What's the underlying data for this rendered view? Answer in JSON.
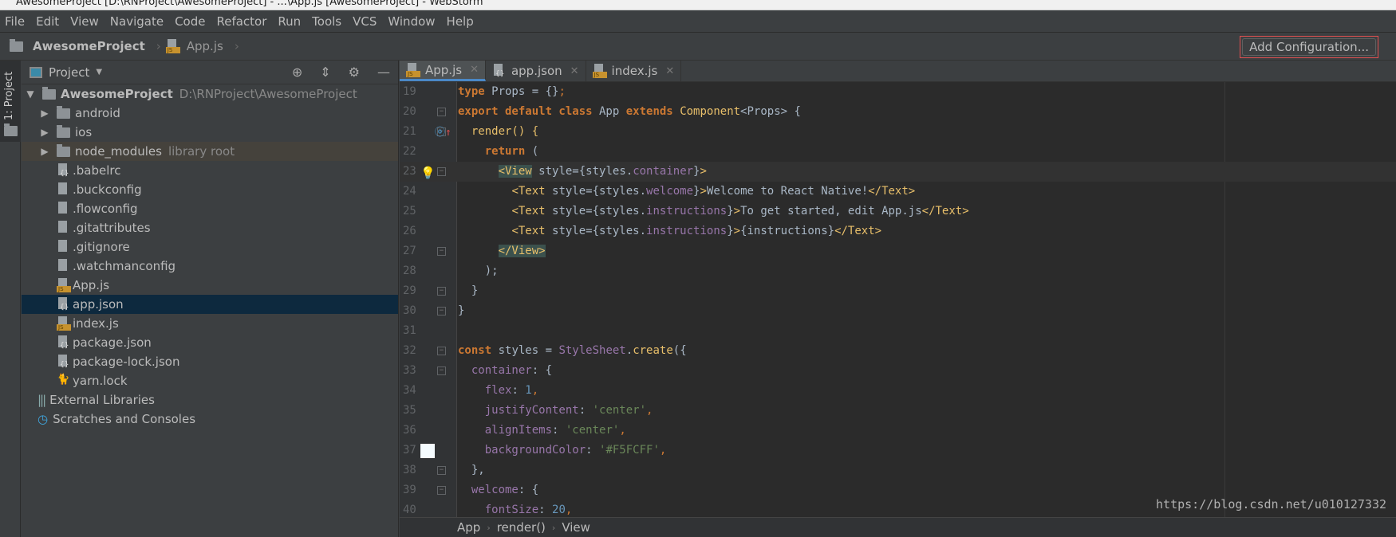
{
  "window": {
    "title": "AwesomeProject [D:\\RNProject\\AwesomeProject] - ...\\App.js [AwesomeProject] - WebStorm"
  },
  "menu": [
    "File",
    "Edit",
    "View",
    "Navigate",
    "Code",
    "Refactor",
    "Run",
    "Tools",
    "VCS",
    "Window",
    "Help"
  ],
  "nav": {
    "project": "AwesomeProject",
    "file": "App.js",
    "add_config": "Add Configuration..."
  },
  "stripe": {
    "project_tab": "1: Project"
  },
  "panel": {
    "title": "Project",
    "root": {
      "name": "AwesomeProject",
      "path": "D:\\RNProject\\AwesomeProject"
    },
    "items": [
      {
        "name": "android",
        "type": "folder"
      },
      {
        "name": "ios",
        "type": "folder"
      },
      {
        "name": "node_modules",
        "type": "folder",
        "note": "library root"
      },
      {
        "name": ".babelrc",
        "type": "json"
      },
      {
        "name": ".buckconfig",
        "type": "text"
      },
      {
        "name": ".flowconfig",
        "type": "text"
      },
      {
        "name": ".gitattributes",
        "type": "text"
      },
      {
        "name": ".gitignore",
        "type": "text"
      },
      {
        "name": ".watchmanconfig",
        "type": "text"
      },
      {
        "name": "App.js",
        "type": "js"
      },
      {
        "name": "app.json",
        "type": "json",
        "selected": true
      },
      {
        "name": "index.js",
        "type": "js"
      },
      {
        "name": "package.json",
        "type": "json"
      },
      {
        "name": "package-lock.json",
        "type": "json"
      },
      {
        "name": "yarn.lock",
        "type": "yarn"
      }
    ],
    "extra": [
      "External Libraries",
      "Scratches and Consoles"
    ]
  },
  "tabs": [
    {
      "label": "App.js",
      "type": "js",
      "active": true
    },
    {
      "label": "app.json",
      "type": "json"
    },
    {
      "label": "index.js",
      "type": "js"
    }
  ],
  "code": [
    {
      "n": "19",
      "tokens": [
        [
          "type",
          "k"
        ],
        [
          " Props = {}",
          "d"
        ],
        [
          ";",
          "g"
        ]
      ]
    },
    {
      "n": "20",
      "tokens": [
        [
          "export default class",
          "k"
        ],
        [
          " App ",
          "d"
        ],
        [
          "extends",
          "k"
        ],
        [
          " ",
          "d"
        ],
        [
          "Component",
          "t"
        ],
        [
          "<Props> {",
          "d"
        ]
      ],
      "fold": true
    },
    {
      "n": "21",
      "tokens": [
        [
          "  render() {",
          "t"
        ]
      ],
      "fold": true,
      "override": true
    },
    {
      "n": "22",
      "tokens": [
        [
          "    ",
          "d"
        ],
        [
          "return",
          "k"
        ],
        [
          " (",
          "d"
        ]
      ]
    },
    {
      "n": "23",
      "tokens": [
        [
          "      ",
          "d"
        ],
        [
          "<View",
          "tv"
        ],
        [
          " style=",
          "d"
        ],
        [
          "{styles.",
          "d"
        ],
        [
          "container",
          "p"
        ],
        [
          "}",
          "d"
        ],
        [
          ">",
          "t"
        ]
      ],
      "fold": true,
      "current": true,
      "bulb": true
    },
    {
      "n": "24",
      "tokens": [
        [
          "        ",
          "d"
        ],
        [
          "<Text",
          "t"
        ],
        [
          " style={styles.",
          "d"
        ],
        [
          "welcome",
          "p"
        ],
        [
          "}",
          "d"
        ],
        [
          ">",
          "t"
        ],
        [
          "Welcome to React Native!",
          "d"
        ],
        [
          "</Text>",
          "t"
        ]
      ]
    },
    {
      "n": "25",
      "tokens": [
        [
          "        ",
          "d"
        ],
        [
          "<Text",
          "t"
        ],
        [
          " style={styles.",
          "d"
        ],
        [
          "instructions",
          "p"
        ],
        [
          "}",
          "d"
        ],
        [
          ">",
          "t"
        ],
        [
          "To get started, edit App.js",
          "d"
        ],
        [
          "</Text>",
          "t"
        ]
      ]
    },
    {
      "n": "26",
      "tokens": [
        [
          "        ",
          "d"
        ],
        [
          "<Text",
          "t"
        ],
        [
          " style={styles.",
          "d"
        ],
        [
          "instructions",
          "p"
        ],
        [
          "}",
          "d"
        ],
        [
          ">",
          "t"
        ],
        [
          "{instructions}",
          "d"
        ],
        [
          "</Text>",
          "t"
        ]
      ]
    },
    {
      "n": "27",
      "tokens": [
        [
          "      ",
          "d"
        ],
        [
          "</View>",
          "tv"
        ]
      ],
      "fold": true
    },
    {
      "n": "28",
      "tokens": [
        [
          "    );",
          "d"
        ]
      ]
    },
    {
      "n": "29",
      "tokens": [
        [
          "  }",
          "d"
        ]
      ],
      "fold": true
    },
    {
      "n": "30",
      "tokens": [
        [
          "}",
          "d"
        ]
      ],
      "fold": true
    },
    {
      "n": "31",
      "tokens": []
    },
    {
      "n": "32",
      "tokens": [
        [
          "const",
          "k"
        ],
        [
          " styles = ",
          "d"
        ],
        [
          "StyleSheet",
          "p"
        ],
        [
          ".",
          "d"
        ],
        [
          "create",
          "t"
        ],
        [
          "({",
          "d"
        ]
      ],
      "fold": true
    },
    {
      "n": "33",
      "tokens": [
        [
          "  ",
          "d"
        ],
        [
          "container",
          "p"
        ],
        [
          ": {",
          "d"
        ]
      ],
      "fold": true
    },
    {
      "n": "34",
      "tokens": [
        [
          "    ",
          "d"
        ],
        [
          "flex",
          "p"
        ],
        [
          ": ",
          "d"
        ],
        [
          "1",
          "n"
        ],
        [
          ",",
          "g"
        ]
      ]
    },
    {
      "n": "35",
      "tokens": [
        [
          "    ",
          "d"
        ],
        [
          "justifyContent",
          "p"
        ],
        [
          ": ",
          "d"
        ],
        [
          "'center'",
          "s"
        ],
        [
          ",",
          "g"
        ]
      ]
    },
    {
      "n": "36",
      "tokens": [
        [
          "    ",
          "d"
        ],
        [
          "alignItems",
          "p"
        ],
        [
          ": ",
          "d"
        ],
        [
          "'center'",
          "s"
        ],
        [
          ",",
          "g"
        ]
      ]
    },
    {
      "n": "37",
      "tokens": [
        [
          "    ",
          "d"
        ],
        [
          "backgroundColor",
          "p"
        ],
        [
          ": ",
          "d"
        ],
        [
          "'#F5FCFF'",
          "s"
        ],
        [
          ",",
          "g"
        ]
      ],
      "swatch": "#F5FCFF"
    },
    {
      "n": "38",
      "tokens": [
        [
          "  },",
          "d"
        ]
      ],
      "fold": true
    },
    {
      "n": "39",
      "tokens": [
        [
          "  ",
          "d"
        ],
        [
          "welcome",
          "p"
        ],
        [
          ": {",
          "d"
        ]
      ],
      "fold": true
    },
    {
      "n": "40",
      "tokens": [
        [
          "    ",
          "d"
        ],
        [
          "fontSize",
          "p"
        ],
        [
          ": ",
          "d"
        ],
        [
          "20",
          "n"
        ],
        [
          ",",
          "g"
        ]
      ]
    }
  ],
  "breadcrumb": [
    "App",
    "render()",
    "View"
  ],
  "watermark": "https://blog.csdn.net/u010127332",
  "colors": {
    "accent": "#4a88c7",
    "selection": "#0d293e",
    "keyword": "#cc7832",
    "tag": "#e8bf6a",
    "property": "#9876aa",
    "string": "#6a8759",
    "number": "#6897bb"
  }
}
